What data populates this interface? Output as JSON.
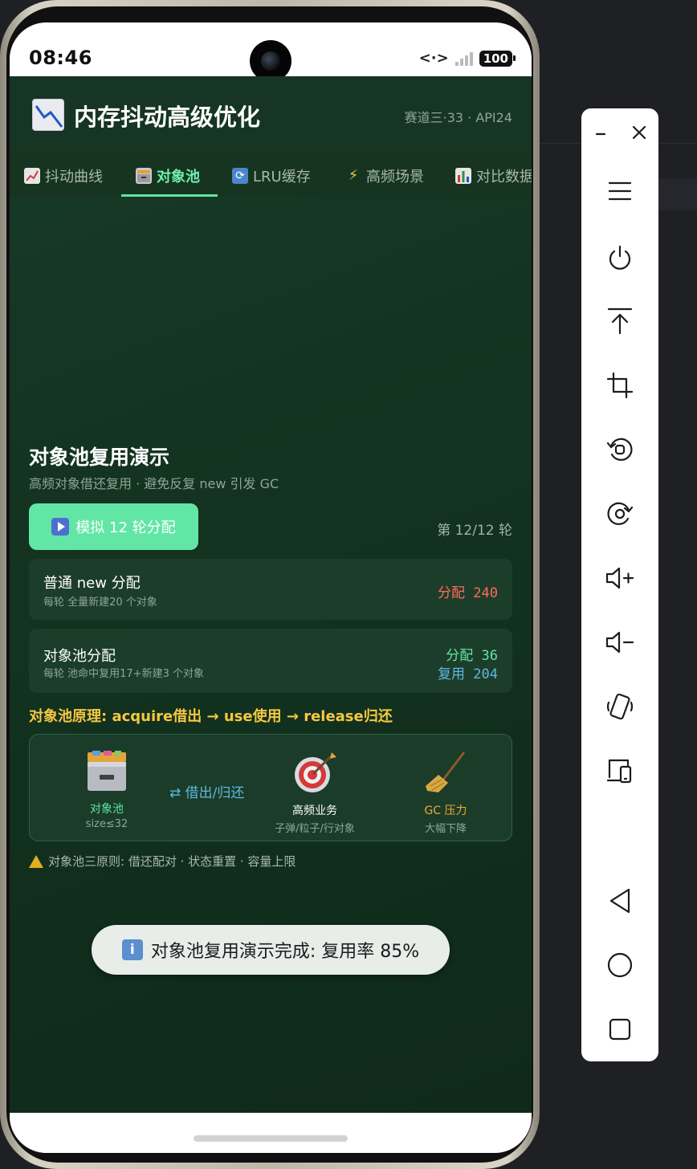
{
  "status_bar": {
    "time": "08:46",
    "battery": "100"
  },
  "app": {
    "title": "内存抖动高级优化",
    "meta": "赛道三·33 · API24",
    "logo_icon": "chart-down-icon"
  },
  "tabs": [
    {
      "label": "抖动曲线",
      "icon": "chart-up-icon",
      "active": false
    },
    {
      "label": "对象池",
      "icon": "file-cabinet-icon",
      "active": true
    },
    {
      "label": "LRU缓存",
      "icon": "refresh-icon",
      "active": false
    },
    {
      "label": "高频场景",
      "icon": "lightning-icon",
      "active": false
    },
    {
      "label": "对比数据",
      "icon": "bar-chart-icon",
      "active": false
    }
  ],
  "section": {
    "title": "对象池复用演示",
    "subtitle": "高频对象借还复用 · 避免反复 new 引发 GC"
  },
  "controls": {
    "run_label": "模拟 12 轮分配",
    "round_label": "第 12/12 轮"
  },
  "cards": {
    "plain_new": {
      "title": "普通 new 分配",
      "desc": "每轮 全量新建20 个对象",
      "alloc_label": "分配",
      "alloc_value": "240"
    },
    "pool": {
      "title": "对象池分配",
      "desc": "每轮 池命中复用17+新建3 个对象",
      "alloc_label": "分配",
      "alloc_value": "36",
      "reuse_label": "复用",
      "reuse_value": "204"
    }
  },
  "principle": "对象池原理: acquire借出 → use使用 → release归还",
  "flow": {
    "pool": {
      "name": "对象池",
      "sub": "size≤32",
      "icon": "file-cabinet-icon"
    },
    "arrow": "⇄ 借出/归还",
    "business": {
      "name": "高频业务",
      "sub": "子弹/粒子/行对象",
      "icon": "target-icon"
    },
    "gc": {
      "name": "GC 压力",
      "sub": "大幅下降",
      "icon": "broom-icon"
    }
  },
  "warning": "对象池三原则: 借还配对 · 状态重置 · 容量上限",
  "toast": "对象池复用演示完成: 复用率 85%",
  "colors": {
    "accent": "#62e6a6",
    "tab_active": "#6ef0b0",
    "alloc_bad": "#ff6b5a",
    "alloc_good": "#5fe6a3",
    "reuse": "#5fb8e0",
    "principle": "#f5c842",
    "gc": "#f0a830"
  },
  "toolbar": {
    "items": [
      "minimize-icon",
      "close-icon",
      "menu-icon",
      "power-icon",
      "pin-top-icon",
      "crop-icon",
      "rotate-left-icon",
      "rotate-right-icon",
      "volume-up-icon",
      "volume-down-icon",
      "shake-icon",
      "device-switch-icon",
      "back-icon",
      "home-icon",
      "recents-icon"
    ]
  }
}
